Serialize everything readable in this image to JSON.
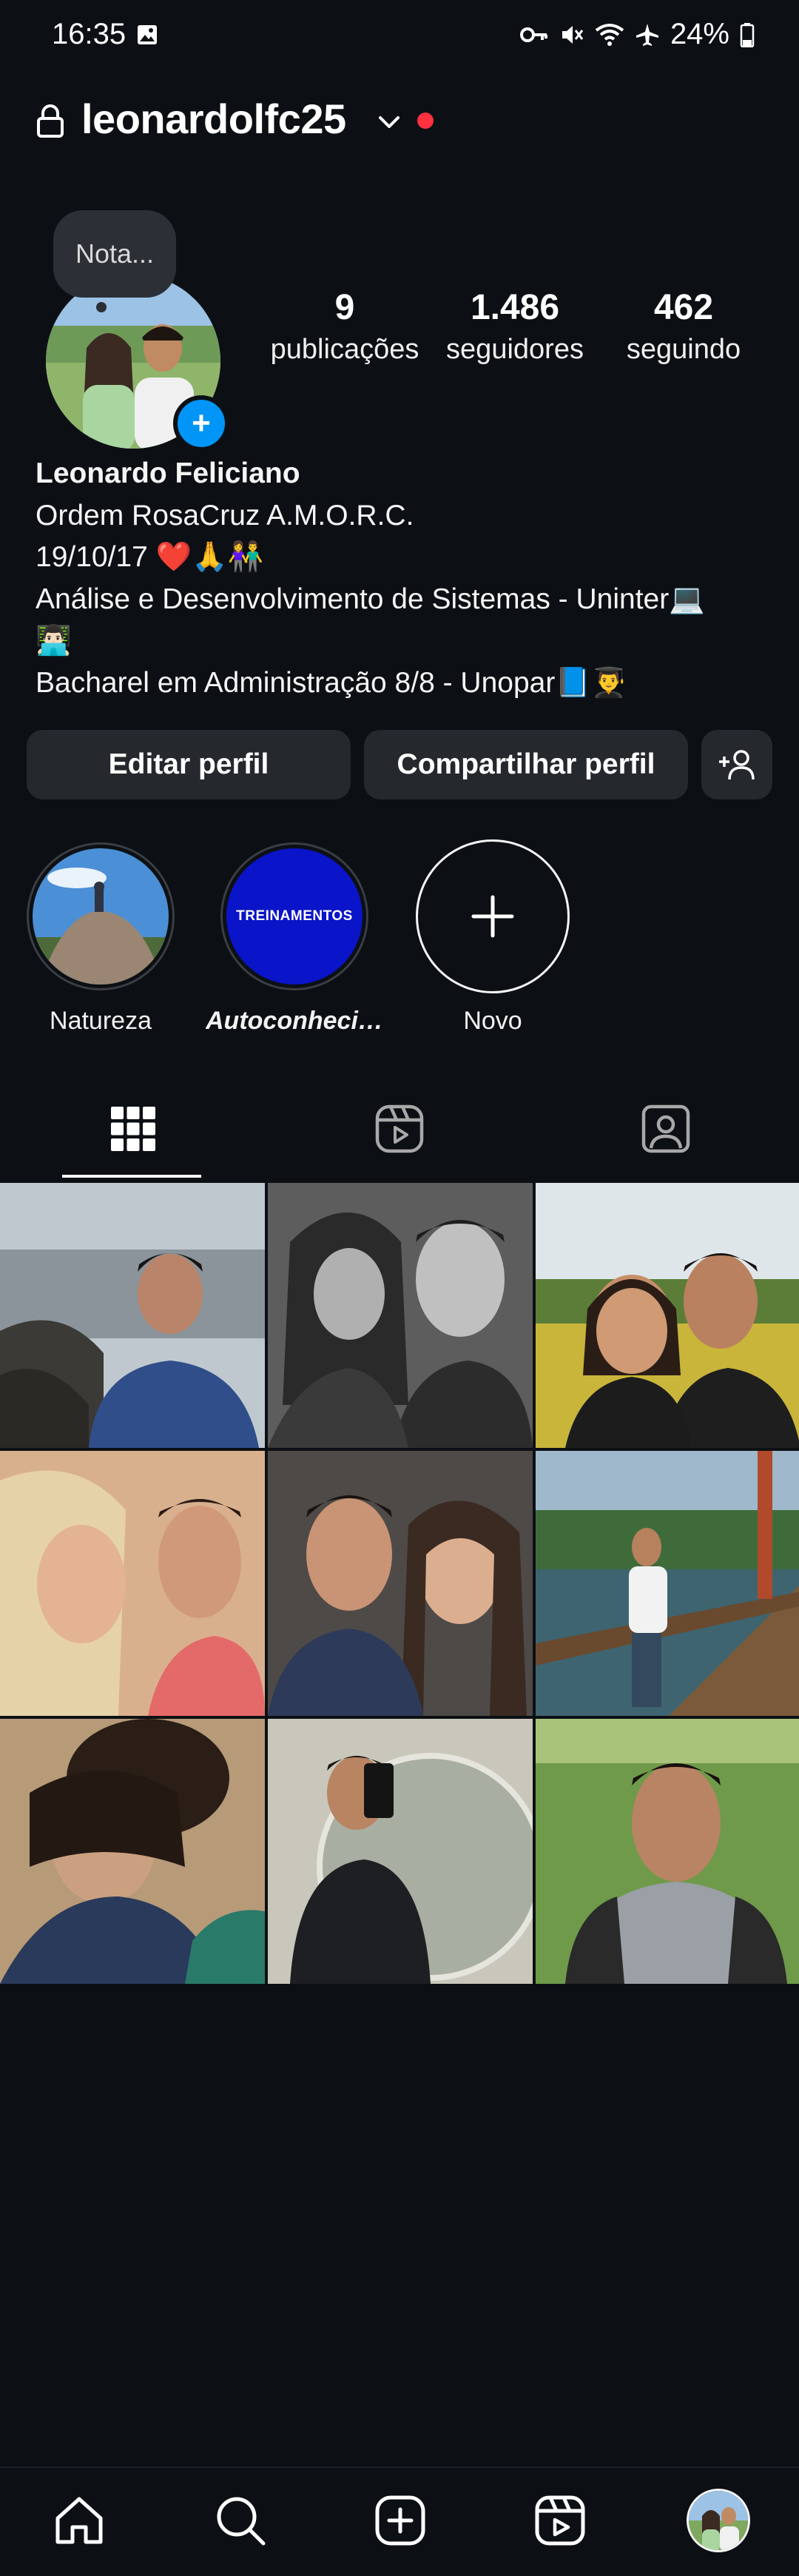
{
  "status_bar": {
    "time": "16:35",
    "battery": "24%",
    "icons": [
      "image-icon",
      "key-icon",
      "mute-icon",
      "wifi-icon",
      "airplane-icon",
      "battery-icon"
    ]
  },
  "header": {
    "username": "leonardolfc25",
    "has_notification_dot": true
  },
  "note": {
    "placeholder": "Nota..."
  },
  "stats": [
    {
      "value": "9",
      "label": "publicações"
    },
    {
      "value": "1.486",
      "label": "seguidores"
    },
    {
      "value": "462",
      "label": "seguindo"
    }
  ],
  "bio": {
    "name": "Leonardo Feliciano",
    "lines": [
      "Ordem RosaCruz A.M.O.R.C.",
      "19/10/17 ❤️🙏👫",
      "Análise e Desenvolvimento de Sistemas - Uninter💻",
      "👨🏻‍💻",
      "Bacharel em Administração 8/8 - Unopar📘👨‍🎓"
    ]
  },
  "buttons": {
    "edit": "Editar perfil",
    "share": "Compartilhar perfil"
  },
  "highlights": [
    {
      "label": "Natureza",
      "icon": "highlight-photo"
    },
    {
      "label": "Autoconhecimento",
      "icon": "highlight-cover",
      "cover_text": "TREINAMENTOS"
    },
    {
      "label": "Novo",
      "icon": "plus-icon"
    }
  ],
  "tabs": [
    {
      "icon": "grid-icon",
      "active": true
    },
    {
      "icon": "reels-icon",
      "active": false
    },
    {
      "icon": "tagged-icon",
      "active": false
    }
  ],
  "posts": [
    {
      "alt": "post-1"
    },
    {
      "alt": "post-2"
    },
    {
      "alt": "post-3"
    },
    {
      "alt": "post-4"
    },
    {
      "alt": "post-5"
    },
    {
      "alt": "post-6"
    },
    {
      "alt": "post-7"
    },
    {
      "alt": "post-8"
    },
    {
      "alt": "post-9"
    }
  ],
  "bottom_nav": [
    "home-icon",
    "search-icon",
    "create-icon",
    "reels-icon",
    "profile-avatar"
  ],
  "colors": {
    "background": "#0c1014",
    "button": "#25292e",
    "accent_blue": "#0095f6",
    "notification_red": "#ff3040"
  }
}
